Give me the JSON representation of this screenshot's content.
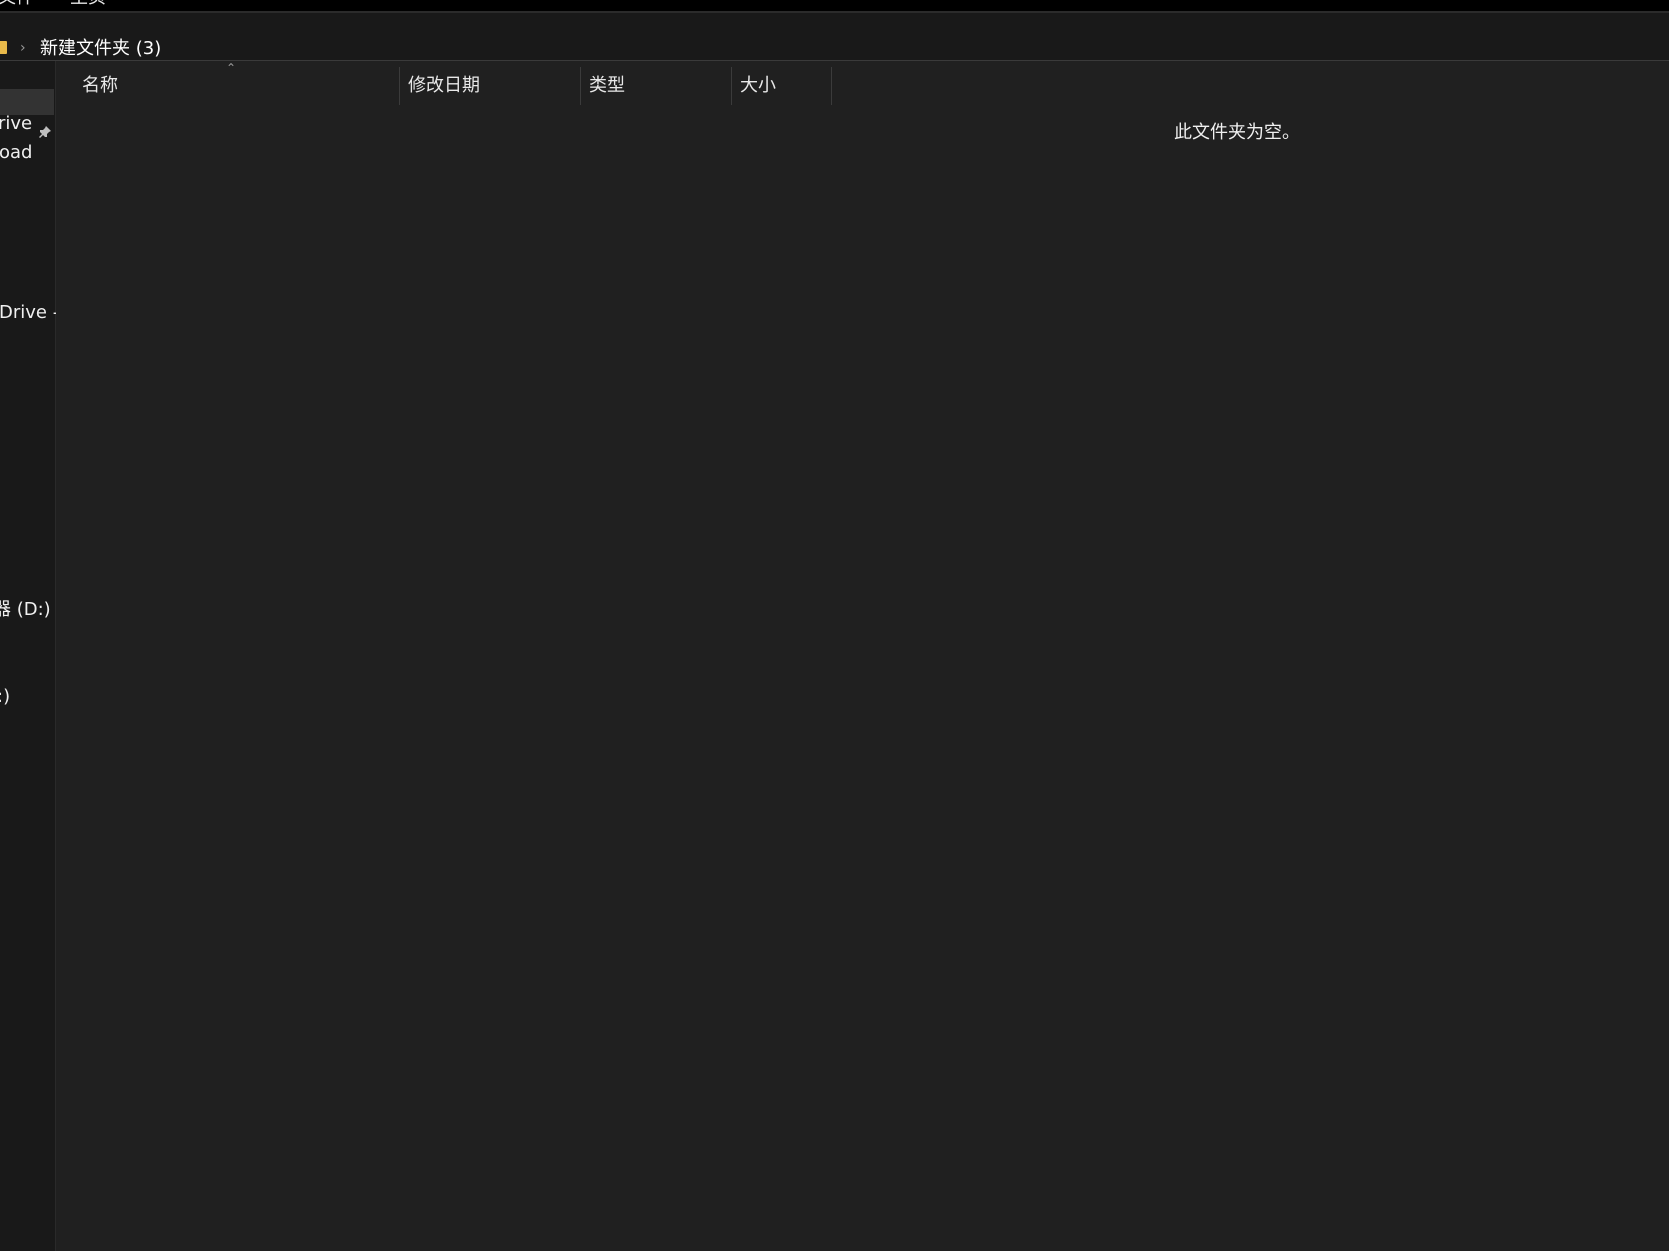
{
  "ribbon": {
    "tabs": [
      "文件",
      "主页"
    ]
  },
  "address_bar": {
    "folder_icon": "folder-icon",
    "separator_icon": "chevron-right-icon",
    "current_folder": "新建文件夹 (3)"
  },
  "nav_pane": {
    "items": [
      "rive",
      "oad",
      "Drive -",
      "器 (D:)",
      ":)"
    ],
    "pinned_icon": "pin-icon"
  },
  "file_list": {
    "columns": [
      "名称",
      "修改日期",
      "类型",
      "大小"
    ],
    "sort_indicator": "chevron-up-icon",
    "empty_message": "此文件夹为空。"
  },
  "colors": {
    "background": "#202020",
    "nav_background": "#191919",
    "folder_accent": "#e8b94a",
    "text": "#ffffff"
  }
}
